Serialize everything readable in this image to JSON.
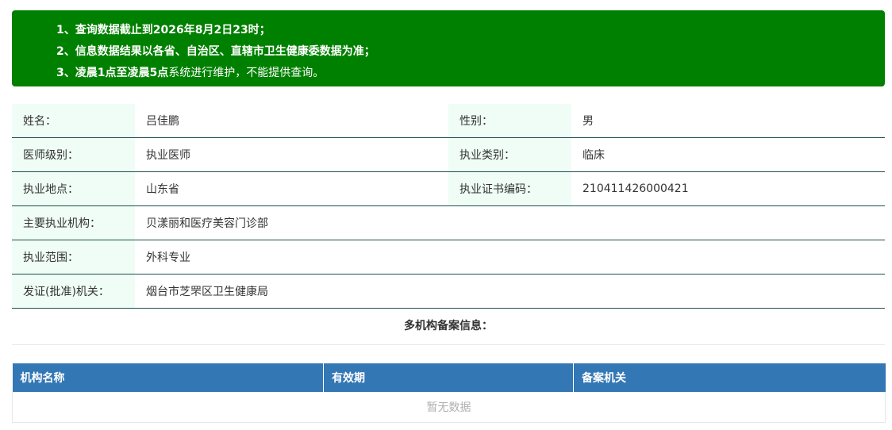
{
  "notice": {
    "line1_prefix": "1、查询数据截止到",
    "line1_bold": "2026年8月2日23时",
    "line1_suffix": "；",
    "line2": "2、信息数据结果以各省、自治区、直辖市卫生健康委数据为准；",
    "line3_prefix": "3、",
    "line3_bold": "凌晨1点至凌晨5点",
    "line3_suffix": "系统进行维护，不能提供查询。",
    "background_color": "#008000"
  },
  "doctor": {
    "name_label": "姓名：",
    "name_value": "吕佳鹏",
    "gender_label": "性别：",
    "gender_value": "男",
    "level_label": "医师级别：",
    "level_value": "执业医师",
    "category_label": "执业类别：",
    "category_value": "临床",
    "location_label": "执业地点：",
    "location_value": "山东省",
    "cert_label": "执业证书编码：",
    "cert_value": "210411426000421",
    "institution_label": "主要执业机构：",
    "institution_value": "贝漾丽和医疗美容门诊部",
    "scope_label": "执业范围：",
    "scope_value": "外科专业",
    "authority_label": "发证(批准)机关：",
    "authority_value": "烟台市芝罘区卫生健康局"
  },
  "multi_org": {
    "title": "多机构备案信息：",
    "columns": [
      "机构名称",
      "有效期",
      "备案机关"
    ],
    "empty_text": "暂无数据",
    "header_color": "#3377b5"
  }
}
